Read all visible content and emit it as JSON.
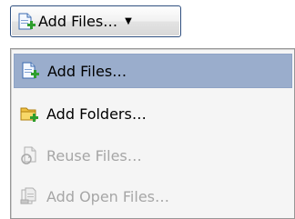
{
  "add_button": {
    "label": "Add Files…",
    "caret": "▼",
    "icon": "add-files-icon"
  },
  "menu": {
    "items": [
      {
        "label": "Add Files…",
        "icon": "add-files-icon",
        "enabled": true,
        "highlighted": true
      },
      {
        "label": "Add Folders…",
        "icon": "add-folder-icon",
        "enabled": true,
        "highlighted": false
      },
      {
        "label": "Reuse Files…",
        "icon": "reuse-files-icon",
        "enabled": false,
        "highlighted": false
      },
      {
        "label": "Add Open Files…",
        "icon": "add-open-files-icon",
        "enabled": false,
        "highlighted": false
      }
    ]
  },
  "colors": {
    "highlight": "#9aadcc",
    "disabled_text": "#a6a6a6",
    "plus_green": "#2e9e2e",
    "folder_yellow": "#f0c040"
  }
}
